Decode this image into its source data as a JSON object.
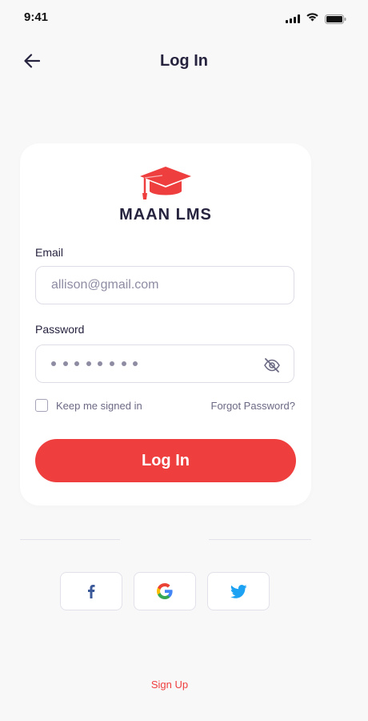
{
  "status_bar": {
    "time": "9:41",
    "icons": [
      "cellular-signal-icon",
      "wifi-icon",
      "battery-icon"
    ]
  },
  "header": {
    "back_icon": "arrow-left-icon",
    "title": "Log In"
  },
  "logo": {
    "icon": "graduation-cap-icon",
    "text": "MAAN LMS",
    "color": "#ef3e3e"
  },
  "form": {
    "email_label": "Email",
    "email_value": "allison@gmail.com",
    "password_label": "Password",
    "password_mask_length": 8,
    "password_toggle_icon": "eye-off-icon",
    "remember_label": "Keep me signed in",
    "remember_checked": false,
    "forgot_label": "Forgot Password?",
    "submit_label": "Log In"
  },
  "social": [
    {
      "name": "facebook",
      "icon": "facebook-icon",
      "color": "#3b5998"
    },
    {
      "name": "google",
      "icon": "google-icon",
      "color": "#4285f4"
    },
    {
      "name": "twitter",
      "icon": "twitter-icon",
      "color": "#1da1f2"
    }
  ],
  "footer": {
    "signup_label": "Sign Up"
  },
  "colors": {
    "accent": "#ef3e3e",
    "text_dark": "#26233f",
    "text_muted": "#8e8ca3",
    "background": "#f8f8f8"
  }
}
